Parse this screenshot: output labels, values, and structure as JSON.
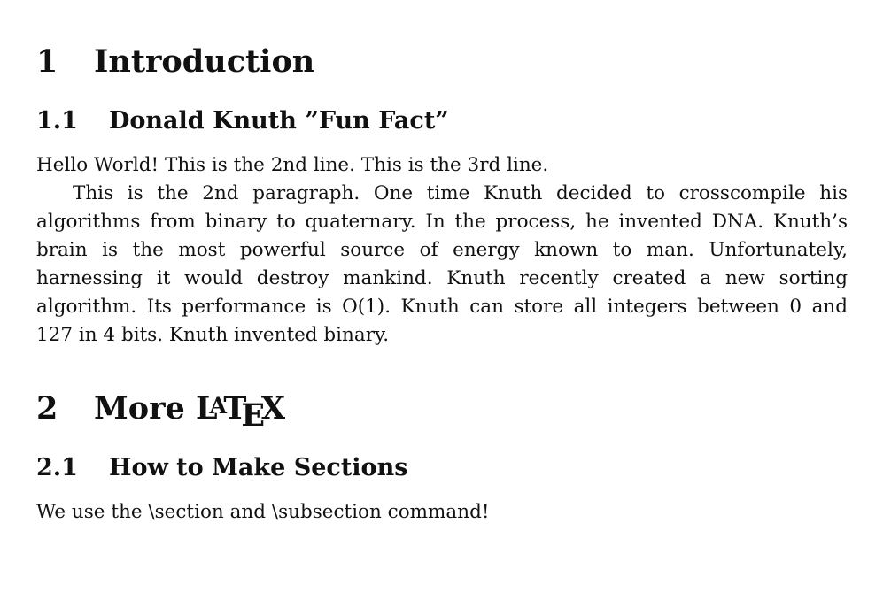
{
  "sections": [
    {
      "number": "1",
      "title": "Introduction",
      "subsection": {
        "number": "1.1",
        "title": "Donald Knuth ”Fun Fact”"
      }
    },
    {
      "number": "2",
      "title_prefix": "More",
      "title_logo": {
        "l": "L",
        "a": "A",
        "t": "T",
        "e": "E",
        "x": "X"
      },
      "subsection": {
        "number": "2.1",
        "title": "How to Make Sections"
      }
    }
  ],
  "paragraphs": {
    "p1": "Hello World! This is the 2nd line. This is the 3rd line.",
    "p2_lines": [
      "This is the 2nd paragraph. One time Knuth decided to crosscompile his",
      "algorithms from binary to quaternary. In the process, he invented DNA. Knuth’s",
      "brain is the most powerful source of energy known to man. Unfortunately,",
      "harnessing it would destroy mankind. Knuth recently created a new sorting",
      "algorithm. Its performance is O(1). Knuth can store all integers between 0 and",
      "127 in 4 bits. Knuth invented binary."
    ],
    "p3": "We use the \\section and \\subsection command!"
  }
}
